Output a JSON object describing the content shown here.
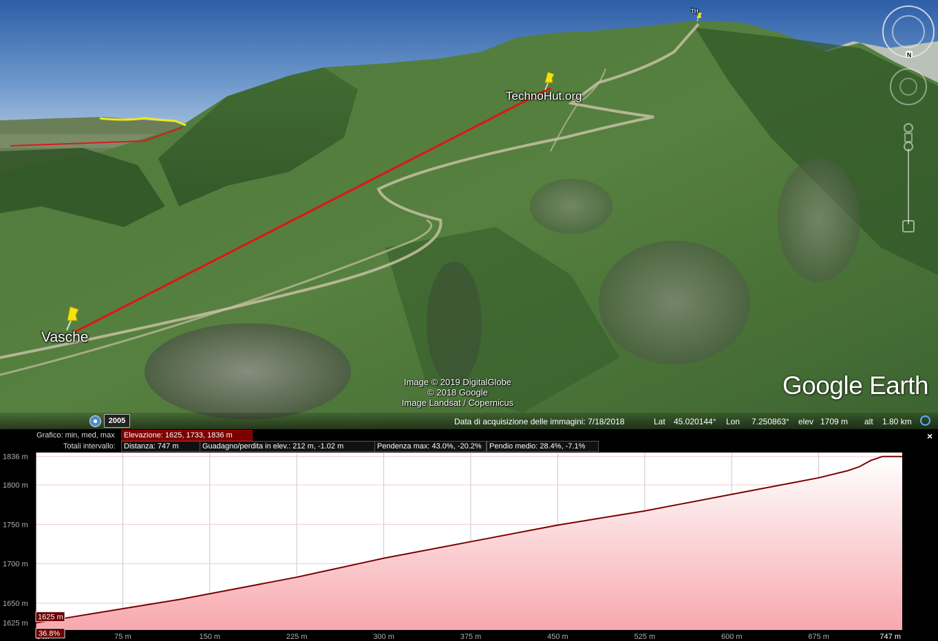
{
  "viewer": {
    "placemarks": [
      {
        "label": "Vasche"
      },
      {
        "label": "TechnoHut.org"
      },
      {
        "label": "TH"
      }
    ],
    "attribution": [
      "Image © 2019 DigitalGlobe",
      "© 2018 Google",
      "Image Landsat / Copernicus"
    ],
    "logo": "Google Earth",
    "year": "2005",
    "compass_north": "N",
    "status": {
      "acquisition": "Data di acquisizione delle immagini: 7/18/2018",
      "lat_label": "Lat",
      "lat_value": "45.020144°",
      "lon_label": "Lon",
      "lon_value": "7.250863°",
      "elev_label": "elev",
      "elev_value": "1709 m",
      "alt_label": "alt",
      "alt_value": "1.80 km"
    }
  },
  "profile": {
    "graph_label": "Grafico: min, med, max",
    "elevation_box": "Elevazione: 1625, 1733, 1836 m",
    "range_label": "Totali intervallo:",
    "distance_box": "Distanza: 747 m",
    "gain_box": "Guadagno/perdita in elev.: 212 m, -1.02 m",
    "slope_box": "Pendenza max: 43.0%, -20.2%",
    "avg_slope_box": "Pendio medio: 28.4%, -7.1%",
    "close": "×",
    "cursor_elev": "1625 m",
    "cursor_slope": "36.8%"
  },
  "chart_data": {
    "type": "area",
    "title": "",
    "xlabel": "",
    "ylabel": "",
    "xlim": [
      0,
      747
    ],
    "ylim": [
      1616,
      1841
    ],
    "x_ticks": [
      "0 m",
      "75 m",
      "150 m",
      "225 m",
      "300 m",
      "375 m",
      "450 m",
      "525 m",
      "600 m",
      "675 m",
      "747 m"
    ],
    "y_ticks": [
      "1625 m",
      "1650 m",
      "1700 m",
      "1750 m",
      "1800 m",
      "1836 m"
    ],
    "series": [
      {
        "x": [
          0,
          25,
          50,
          75,
          100,
          125,
          150,
          175,
          200,
          225,
          250,
          275,
          300,
          325,
          350,
          375,
          400,
          425,
          450,
          475,
          500,
          525,
          550,
          575,
          600,
          625,
          650,
          675,
          700,
          710,
          720,
          730,
          747
        ],
        "y": [
          1625,
          1631,
          1637,
          1643,
          1649,
          1655,
          1662,
          1669,
          1676,
          1683,
          1691,
          1699,
          1707,
          1714,
          1721,
          1728,
          1735,
          1742,
          1749,
          1755,
          1761,
          1767,
          1774,
          1781,
          1788,
          1795,
          1802,
          1809,
          1818,
          1823,
          1831,
          1836,
          1836
        ]
      }
    ],
    "grid": true,
    "colors": {
      "line": "#7a0000",
      "fill_top": "#ffffff",
      "fill_bottom": "#f7a8ad"
    }
  }
}
